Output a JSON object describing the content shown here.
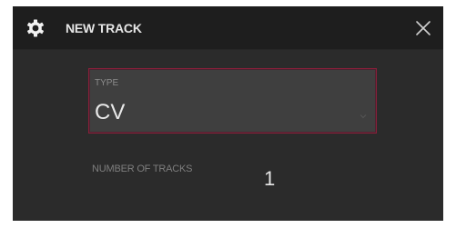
{
  "dialog": {
    "title": "NEW TRACK",
    "icon": "gear-icon",
    "close_icon": "close-icon"
  },
  "type_field": {
    "label": "TYPE",
    "value": "CV"
  },
  "number_of_tracks": {
    "label": "NUMBER OF TRACKS",
    "value": "1"
  },
  "colors": {
    "dialog_background": "#2b2b2b",
    "header_background": "#1e1e1e",
    "field_background": "#3f3f3f",
    "accent_border": "#8a1f3a",
    "text_primary": "#e6e6e6",
    "text_secondary": "#8c8c8c"
  }
}
